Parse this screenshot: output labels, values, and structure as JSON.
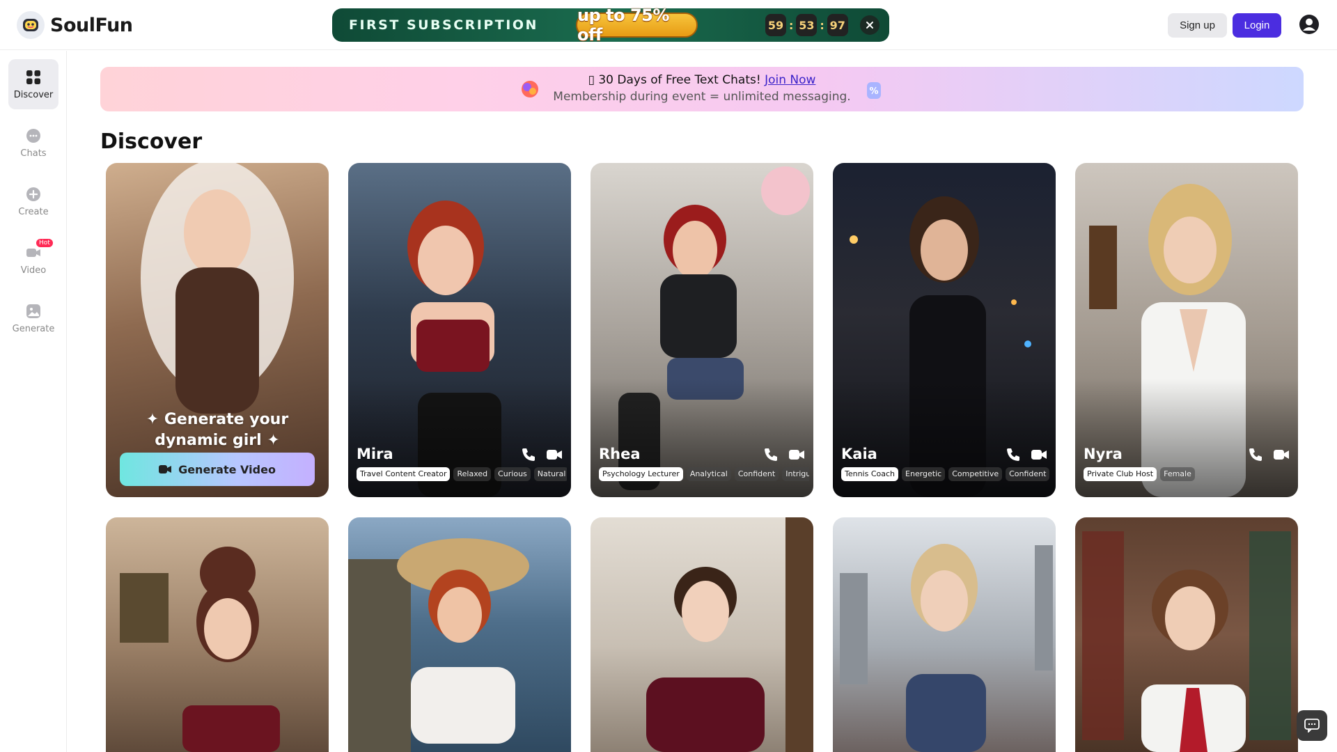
{
  "header": {
    "logo_text": "SoulFun",
    "promo": {
      "title": "FIRST SUBSCRIPTION",
      "offer": "up to 75% off",
      "countdown": [
        "59",
        "53",
        "97"
      ],
      "separator": ":"
    },
    "signup_label": "Sign up",
    "login_label": "Login"
  },
  "sidebar": {
    "items": [
      {
        "label": "Discover",
        "icon": "grid-icon"
      },
      {
        "label": "Chats",
        "icon": "chat-bubble-icon"
      },
      {
        "label": "Create",
        "icon": "plus-circle-icon"
      },
      {
        "label": "Video",
        "icon": "video-camera-icon",
        "badge": "Hot"
      },
      {
        "label": "Generate",
        "icon": "image-icon"
      }
    ]
  },
  "banner": {
    "line1_prefix": "▯ 30 Days of Free Text Chats!",
    "link": "Join Now",
    "line2": "Membership during event = unlimited messaging."
  },
  "main": {
    "title": "Discover",
    "generate_card": {
      "text_line1": "✦ Generate your",
      "text_line2": "dynamic girl ✦",
      "button_label": "Generate Video"
    },
    "cards": [
      {
        "name": "Mira",
        "tags": [
          "Travel Content Creator",
          "Relaxed",
          "Curious",
          "Natural"
        ]
      },
      {
        "name": "Rhea",
        "tags": [
          "Psychology Lecturer",
          "Analytical",
          "Confident",
          "Intriguing"
        ]
      },
      {
        "name": "Kaia",
        "tags": [
          "Tennis Coach",
          "Energetic",
          "Competitive",
          "Confident"
        ]
      },
      {
        "name": "Nyra",
        "tags": [
          "Private Club Host",
          "Female"
        ]
      }
    ]
  },
  "colors": {
    "accent": "#4b2de0",
    "promo_bg": "#0f4a36",
    "hot_badge": "#ff2a55"
  }
}
